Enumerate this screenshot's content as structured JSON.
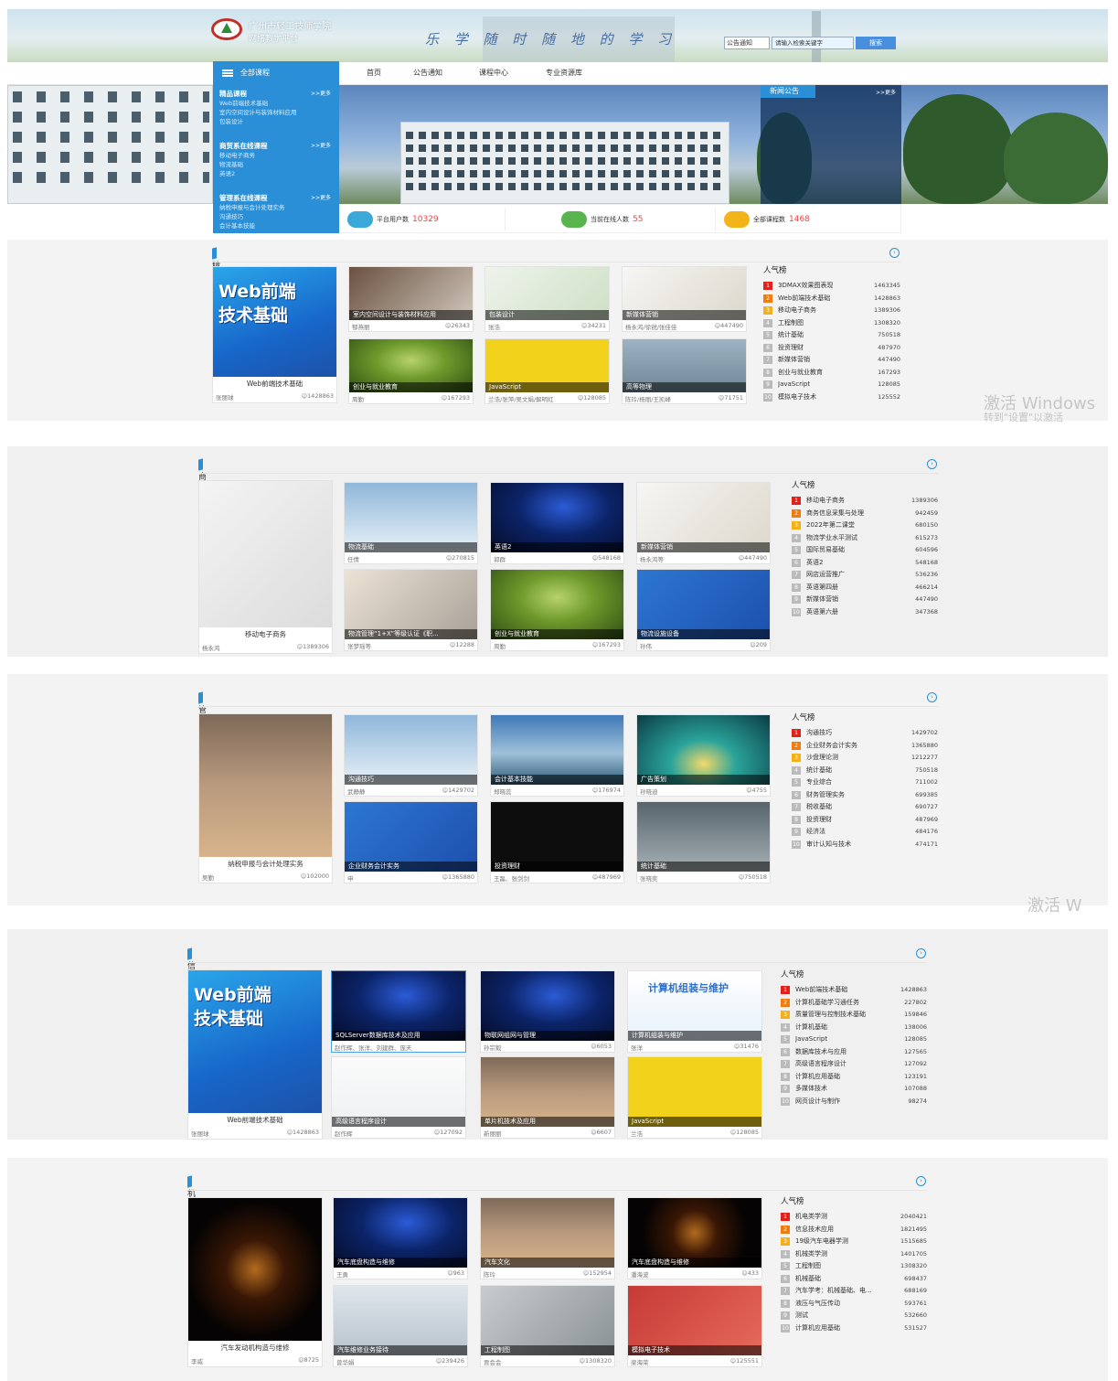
{
  "header": {
    "logo_line1": "广州市轻工技师学院",
    "logo_line2": "网络教学平台",
    "slogan": "乐 学 随 时 随 地 的 学 习",
    "search_select": "公告通知",
    "search_placeholder": "请输入检索关键字",
    "search_button": "搜索"
  },
  "nav": {
    "all_courses": "全部课程",
    "items": [
      "首页",
      "公告通知",
      "课程中心",
      "专业资源库"
    ]
  },
  "menu": {
    "more": ">>更多",
    "groups": [
      {
        "title": "精品课程",
        "items": [
          "Web前端技术基础",
          "室内空间设计与装饰材料应用",
          "包装设计"
        ]
      },
      {
        "title": "商贸系在线课程",
        "items": [
          "移动电子商务",
          "物流基础",
          "英语2"
        ]
      },
      {
        "title": "管理系在线课程",
        "items": [
          "纳税申报与会计处理实务",
          "沟通技巧",
          "会计基本技能"
        ]
      }
    ]
  },
  "news": {
    "title": "新闻公告",
    "more": ">>更多"
  },
  "stats": [
    {
      "label": "平台用户数",
      "value": "10329",
      "icon": "users-icon",
      "color": "#3aa8d8"
    },
    {
      "label": "当前在线人数",
      "value": "55",
      "icon": "monitor-icon",
      "color": "#58b54d"
    },
    {
      "label": "全部课程数",
      "value": "1468",
      "icon": "card-icon",
      "color": "#f2b418"
    }
  ],
  "rank_title": "人气榜",
  "sections": [
    {
      "title": "精品课程",
      "feature": {
        "title": "Web前端技术基础",
        "author": "张丽球",
        "views": "1428863",
        "big1": "Web前端",
        "big2": "技术基础"
      },
      "cards": [
        {
          "cap": "室内空间设计与装饰材料应用",
          "author": "郁燕丽",
          "views": "26343"
        },
        {
          "cap": "包装设计",
          "author": "张浩",
          "views": "34231"
        },
        {
          "cap": "新媒体营销",
          "author": "杨永鸿/徐锐/张佳佳",
          "views": "447490"
        },
        {
          "cap": "创业与就业教育",
          "author": "周勤",
          "views": "167293"
        },
        {
          "cap": "JavaScript",
          "author": "兰浩/张萍/吴文娟/解明红",
          "views": "128085"
        },
        {
          "cap": "高等物理",
          "author": "陈玲/杨丽/王凯峰",
          "views": "71751"
        }
      ],
      "ranking": [
        [
          "3DMAX效果图表现",
          "1463345"
        ],
        [
          "Web前端技术基础",
          "1428863"
        ],
        [
          "移动电子商务",
          "1389306"
        ],
        [
          "工程制图",
          "1308320"
        ],
        [
          "统计基础",
          "750518"
        ],
        [
          "投资理财",
          "487970"
        ],
        [
          "新媒体营销",
          "447490"
        ],
        [
          "创业与就业教育",
          "167293"
        ],
        [
          "JavaScript",
          "128085"
        ],
        [
          "模拟电子技术",
          "125552"
        ]
      ]
    },
    {
      "title": "商贸系在线课程",
      "feature": {
        "title": "移动电子商务",
        "author": "杨永鸿",
        "views": "1389306"
      },
      "cards": [
        {
          "cap": "物流基础",
          "author": "任倩",
          "views": "270815"
        },
        {
          "cap": "英语2",
          "author": "郭群",
          "views": "548168"
        },
        {
          "cap": "新媒体营销",
          "author": "杨永鸿等",
          "views": "447490"
        },
        {
          "cap": "物流管理“1+X”等级认证《职...",
          "author": "张梦瑶等",
          "views": "12288"
        },
        {
          "cap": "创业与就业教育",
          "author": "周勤",
          "views": "167293"
        },
        {
          "cap": "物流设施设备",
          "author": "孙伟",
          "views": "209"
        }
      ],
      "ranking": [
        [
          "移动电子商务",
          "1389306"
        ],
        [
          "商务信息采集与处理",
          "942459"
        ],
        [
          "2022年第二课堂",
          "680150"
        ],
        [
          "物流学业水平测试",
          "615273"
        ],
        [
          "国际贸易基础",
          "604596"
        ],
        [
          "英语2",
          "548168"
        ],
        [
          "网店运营推广",
          "536236"
        ],
        [
          "英语第四册",
          "466214"
        ],
        [
          "新媒体营销",
          "447490"
        ],
        [
          "英语第六册",
          "347368"
        ]
      ]
    },
    {
      "title": "管理系在线课程",
      "feature": {
        "title": "纳税申报与会计处理实务",
        "author": "吴勤",
        "views": "102000"
      },
      "cards": [
        {
          "cap": "沟通技巧",
          "author": "武静静",
          "views": "1429702"
        },
        {
          "cap": "会计基本技能",
          "author": "郑晓蕊",
          "views": "176974"
        },
        {
          "cap": "广告策划",
          "author": "孙晓迪",
          "views": "4755"
        },
        {
          "cap": "企业财务会计实务",
          "author": "申",
          "views": "1365880"
        },
        {
          "cap": "投资理财",
          "author": "王磊、张剑剑",
          "views": "487969"
        },
        {
          "cap": "统计基础",
          "author": "张晓奕",
          "views": "750518"
        }
      ],
      "ranking": [
        [
          "沟通技巧",
          "1429702"
        ],
        [
          "企业财务会计实务",
          "1365880"
        ],
        [
          "沙盘理论测",
          "1212277"
        ],
        [
          "统计基础",
          "750518"
        ],
        [
          "专业综合",
          "711002"
        ],
        [
          "财务管理实务",
          "699385"
        ],
        [
          "税收基础",
          "690727"
        ],
        [
          "投资理财",
          "487969"
        ],
        [
          "经济法",
          "484176"
        ],
        [
          "审计认知与技术",
          "474171"
        ]
      ]
    },
    {
      "title": "信息系在线课程",
      "feature": {
        "title": "Web前端技术基础",
        "author": "张丽球",
        "views": "1428863",
        "big1": "Web前端",
        "big2": "技术基础"
      },
      "cards": [
        {
          "cap": "SQLServer数据库技术及应用",
          "author": "赵作辉、张洋、刘建群、庞天",
          "views": "",
          "selected": true
        },
        {
          "cap": "物联网组网与管理",
          "author": "孙宗毅",
          "views": "6053"
        },
        {
          "cap": "计算机组装与维护",
          "author": "张洋",
          "views": "31476",
          "banner": "计算机组装与维护"
        },
        {
          "cap": "高级语言程序设计",
          "author": "赵作辉",
          "views": "127092"
        },
        {
          "cap": "单片机技术及应用",
          "author": "新丽丽",
          "views": "6607"
        },
        {
          "cap": "JavaScript",
          "author": "兰浩",
          "views": "128085"
        }
      ],
      "ranking": [
        [
          "Web前端技术基础",
          "1428863"
        ],
        [
          "计算机基础学习通任务",
          "227802"
        ],
        [
          "质量管理与控制技术基础",
          "159846"
        ],
        [
          "计算机基础",
          "138006"
        ],
        [
          "JavaScript",
          "128085"
        ],
        [
          "数据库技术与应用",
          "127565"
        ],
        [
          "高级语言程序设计",
          "127092"
        ],
        [
          "计算机应用基础",
          "123191"
        ],
        [
          "多媒体技术",
          "107088"
        ],
        [
          "网页设计与制作",
          "98274"
        ]
      ]
    },
    {
      "title": "机电系在线课程",
      "feature": {
        "title": "汽车发动机构造与维修",
        "author": "李威",
        "views": "8725"
      },
      "cards": [
        {
          "cap": "汽车底盘构造与维修",
          "author": "王勇",
          "views": "963"
        },
        {
          "cap": "汽车文化",
          "author": "陈玲",
          "views": "152954"
        },
        {
          "cap": "汽车底盘构造与维修",
          "author": "潘海波",
          "views": "433"
        },
        {
          "cap": "汽车维修业务接待",
          "author": "曾华娟",
          "views": "239426"
        },
        {
          "cap": "工程制图",
          "author": "贾会会",
          "views": "1308320"
        },
        {
          "cap": "模拟电子技术",
          "author": "梁海荣",
          "views": "125551"
        }
      ],
      "ranking": [
        [
          "机电类学测",
          "2040421"
        ],
        [
          "信息技术应用",
          "1821495"
        ],
        [
          "19级汽车电器学测",
          "1515685"
        ],
        [
          "机械类学测",
          "1401705"
        ],
        [
          "工程制图",
          "1308320"
        ],
        [
          "机械基础",
          "698437"
        ],
        [
          "汽车学考：机械基础、电...",
          "688169"
        ],
        [
          "液压与气压传动",
          "593761"
        ],
        [
          "测试",
          "532660"
        ],
        [
          "计算机应用基础",
          "531527"
        ]
      ]
    }
  ],
  "watermark": {
    "line1": "激活 Windows",
    "line2": "转到\"设置\"以激活",
    "short": "激活 W"
  }
}
